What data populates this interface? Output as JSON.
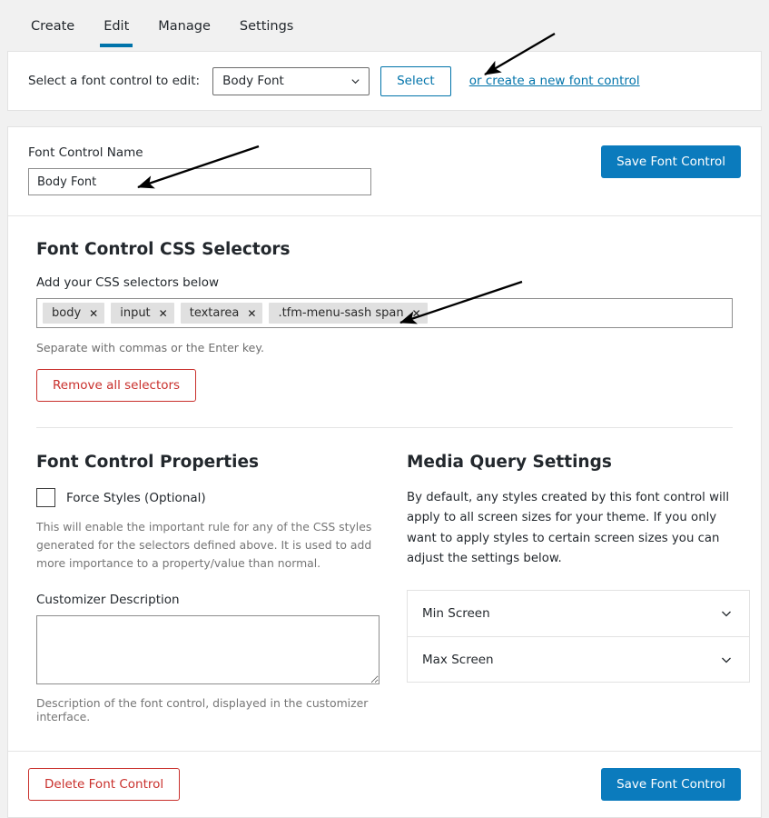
{
  "tabs": [
    {
      "label": "Create",
      "active": false
    },
    {
      "label": "Edit",
      "active": true
    },
    {
      "label": "Manage",
      "active": false
    },
    {
      "label": "Settings",
      "active": false
    }
  ],
  "select_bar": {
    "label": "Select a font control to edit:",
    "selected_option": "Body Font",
    "options": [
      "Body Font"
    ],
    "select_button": "Select",
    "create_link": "or create a new font control"
  },
  "name_section": {
    "label": "Font Control Name",
    "value": "Body Font",
    "save_button": "Save Font Control"
  },
  "selectors_section": {
    "title": "Font Control CSS Selectors",
    "sub_label": "Add your CSS selectors below",
    "chips": [
      "body",
      "input",
      "textarea",
      ".tfm-menu-sash span"
    ],
    "chip_remove_glyph": "✕",
    "help": "Separate with commas or the Enter key.",
    "remove_all_button": "Remove all selectors"
  },
  "properties_section": {
    "title": "Font Control Properties",
    "force_styles_label": "Force Styles (Optional)",
    "force_styles_checked": false,
    "force_styles_description": "This will enable the important rule for any of the CSS styles generated for the selectors defined above. It is used to add more importance to a property/value than normal.",
    "customizer_label": "Customizer Description",
    "customizer_value": "",
    "customizer_placeholder": "",
    "customizer_caption": "Description of the font control, displayed in the customizer interface."
  },
  "media_query_section": {
    "title": "Media Query Settings",
    "intro": "By default, any styles created by this font control will apply to all screen sizes for your theme. If you only want to apply styles to certain screen sizes you can adjust the settings below.",
    "rows": [
      {
        "label": "Min Screen"
      },
      {
        "label": "Max Screen"
      }
    ]
  },
  "footer": {
    "delete_button": "Delete Font Control",
    "save_button": "Save Font Control"
  },
  "colors": {
    "accent_blue": "#0073aa",
    "primary_button": "#0b7bbd",
    "danger_red": "#c9302c",
    "page_background": "#f1f1f1",
    "panel_background": "#ffffff",
    "chip_background": "#e0e0e0"
  }
}
